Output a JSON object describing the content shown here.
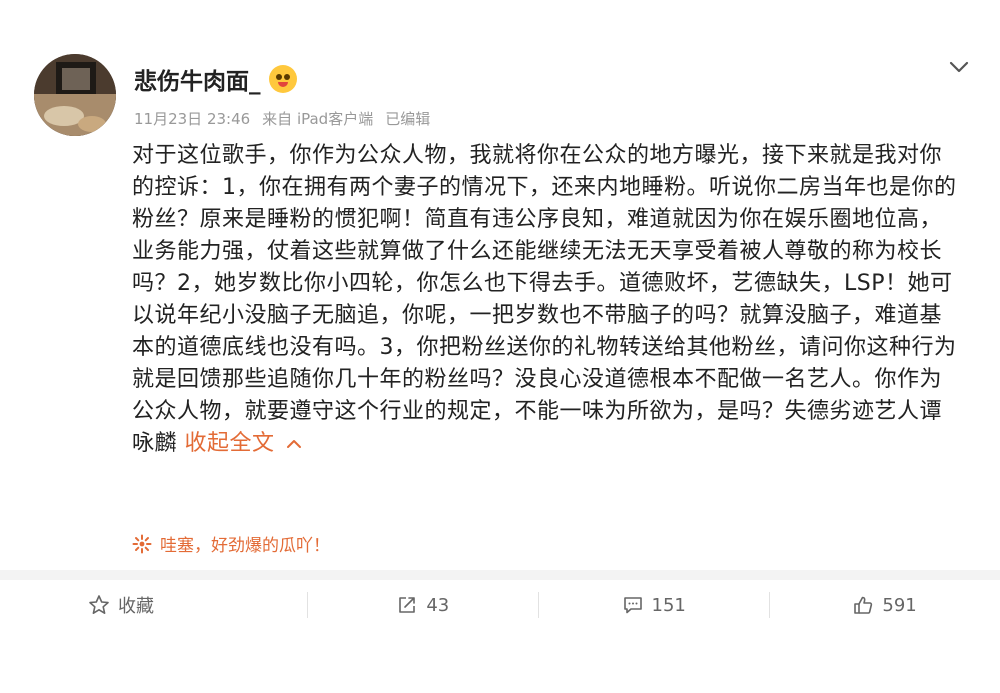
{
  "post": {
    "username": "悲伤牛肉面_",
    "emoji_icon": "laughing-emoji-icon",
    "date": "11月23日 23:46",
    "source": "来自 iPad客户端",
    "edited": "已编辑",
    "content": "对于这位歌手，你作为公众人物，我就将你在公众的地方曝光，接下来就是我对你的控诉：1，你在拥有两个妻子的情况下，还来内地睡粉。听说你二房当年也是你的粉丝？原来是睡粉的惯犯啊！简直有违公序良知，难道就因为你在娱乐圈地位高，业务能力强，仗着这些就算做了什么还能继续无法无天享受着被人尊敬的称为校长吗？2，她岁数比你小四轮，你怎么也下得去手。道德败坏，艺德缺失，LSP！她可以说年纪小没脑子无脑追，你呢，一把岁数也不带脑子的吗？就算没脑子，难道基本的道德底线也没有吗。3，你把粉丝送你的礼物转送给其他粉丝，请问你这种行为就是回馈那些追随你几十年的粉丝吗？没良心没道德根本不配做一名艺人。你作为公众人物，就要遵守这个行业的规定，不能一味为所欲为，是吗？失德劣迹艺人谭咏麟",
    "collapse_label": "收起全文",
    "wow_text": "哇塞，好劲爆的瓜吖！"
  },
  "actions": {
    "favorite_label": "收藏",
    "repost_count": "43",
    "comment_count": "151",
    "like_count": "591"
  },
  "colors": {
    "accent": "#e36b36",
    "meta": "#999999",
    "text": "#222222"
  }
}
